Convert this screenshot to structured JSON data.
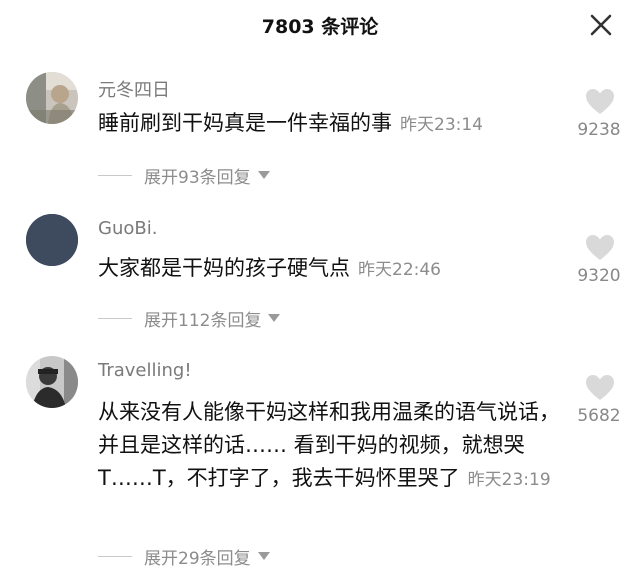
{
  "header": {
    "title": "7803 条评论"
  },
  "comments": [
    {
      "username": "元冬四日",
      "text": "睡前刷到干妈真是一件幸福的事",
      "time": "昨天23:14",
      "likes": "9238",
      "expand": "展开93条回复"
    },
    {
      "username": "GuoBi.",
      "text": "大家都是干妈的孩子硬气点",
      "time": "昨天22:46",
      "likes": "9320",
      "expand": "展开112条回复"
    },
    {
      "username": "Travelling!",
      "text": "从来没有人能像干妈这样和我用温柔的语气说话，并且是这样的话…… 看到干妈的视频，就想哭T……T，不打字了，我去干妈怀里哭了",
      "time": "昨天23:19",
      "likes": "5682",
      "expand": "展开29条回复"
    }
  ],
  "icons": {
    "close": "close-icon",
    "like": "heart-icon",
    "expand_caret": "caret-down-icon"
  },
  "colors": {
    "username": "#7a7a7a",
    "secondary": "#8c8c8c",
    "heart": "#d9d9d9",
    "avatar_guobi": "#3e4a5e"
  }
}
